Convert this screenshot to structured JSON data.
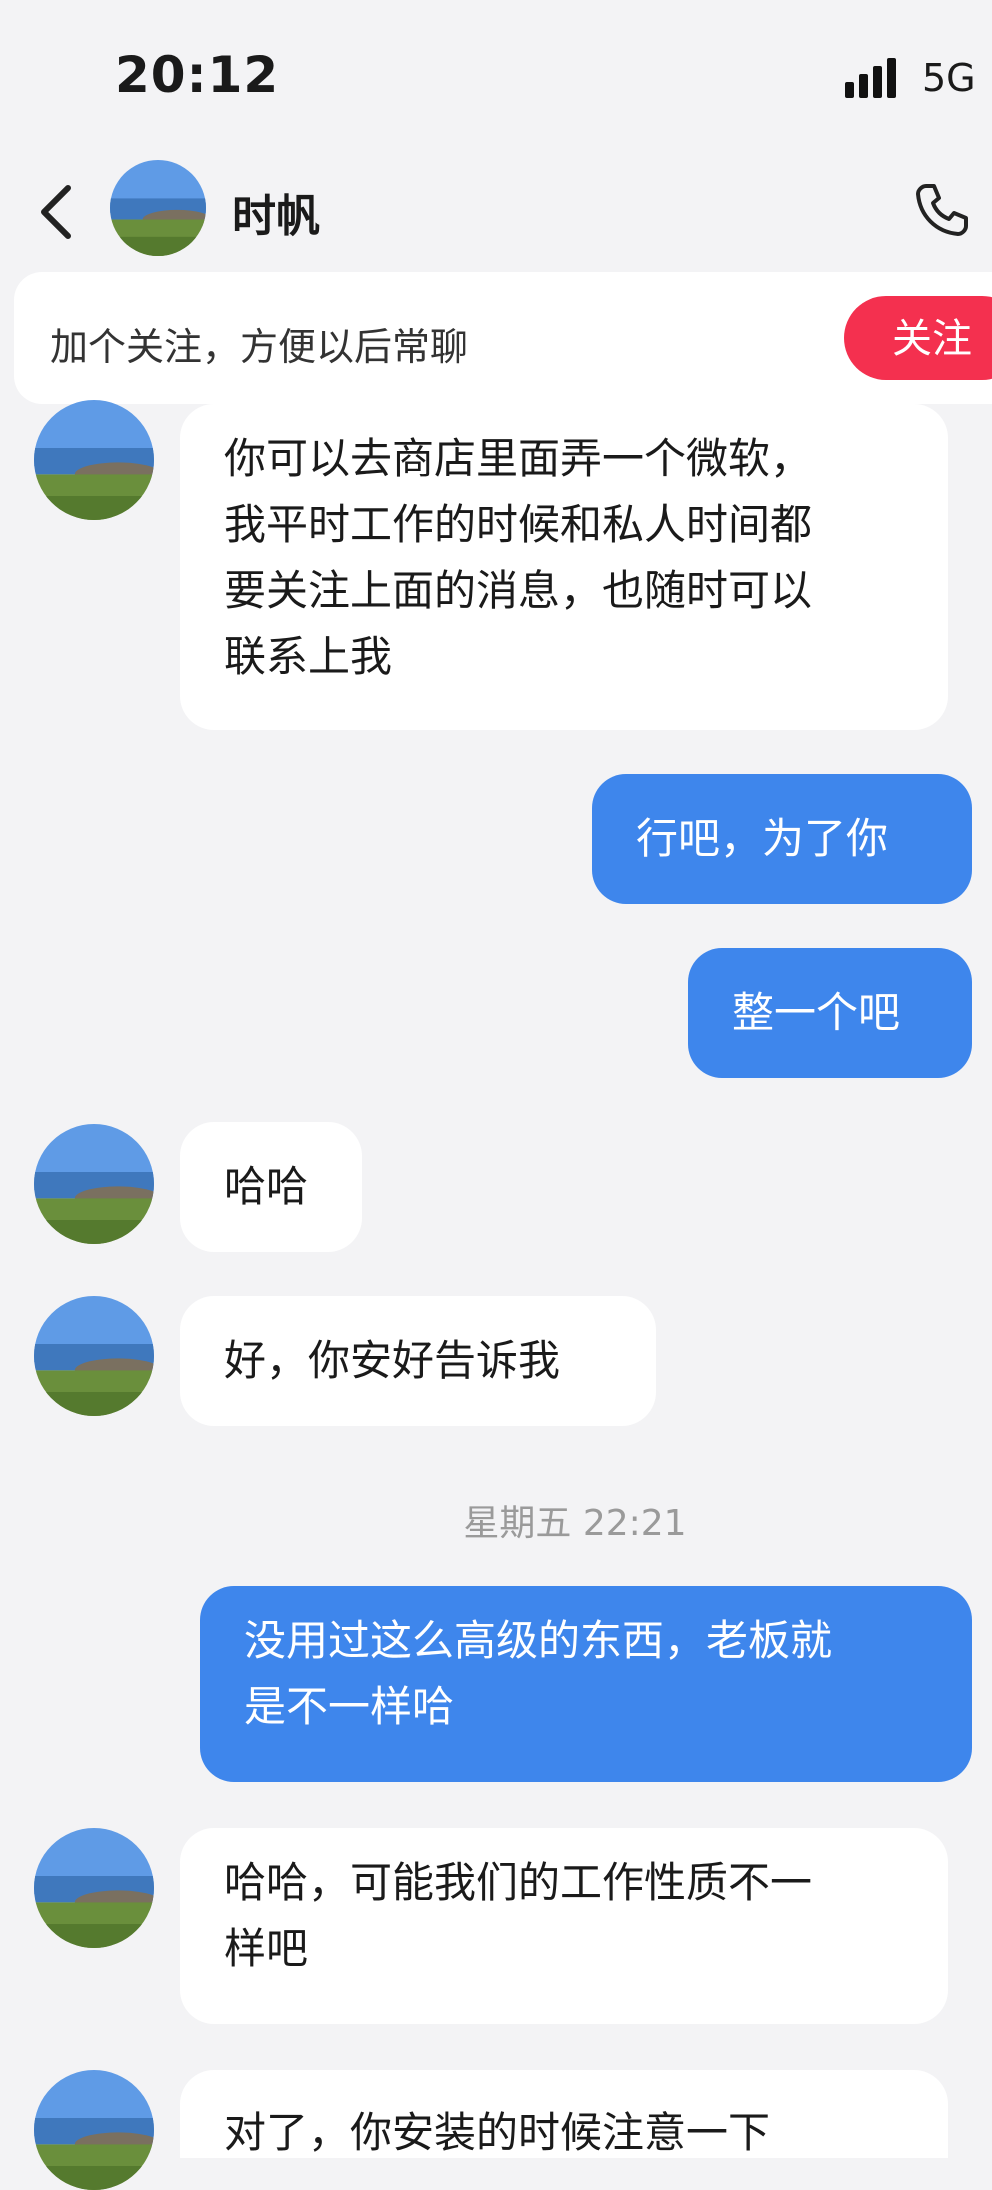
{
  "status_bar": {
    "time": "20:12",
    "network": "5G"
  },
  "header": {
    "contact_name": "时帆"
  },
  "follow_banner": {
    "text": "加个关注，方便以后常聊",
    "button": "关注"
  },
  "timestamp": "星期五 22:21",
  "messages": [
    {
      "direction": "incoming",
      "text": "你可以去商店里面弄一个微软，\n我平时工作的时候和私人时间都\n要关注上面的消息，也随时可以\n联系上我"
    },
    {
      "direction": "outgoing",
      "text": "行吧，为了你"
    },
    {
      "direction": "outgoing",
      "text": "整一个吧"
    },
    {
      "direction": "incoming",
      "text": "哈哈"
    },
    {
      "direction": "incoming",
      "text": "好，你安好告诉我"
    },
    {
      "direction": "outgoing",
      "text": "没用过这么高级的东西，老板就\n是不一样哈"
    },
    {
      "direction": "incoming",
      "text": "哈哈，可能我们的工作性质不一\n样吧"
    },
    {
      "direction": "incoming",
      "text": "对了，你安装的时候注意一下"
    }
  ],
  "icons": {
    "back": "chevron-left-icon",
    "phone": "phone-icon",
    "signal": "signal-bars-icon"
  }
}
